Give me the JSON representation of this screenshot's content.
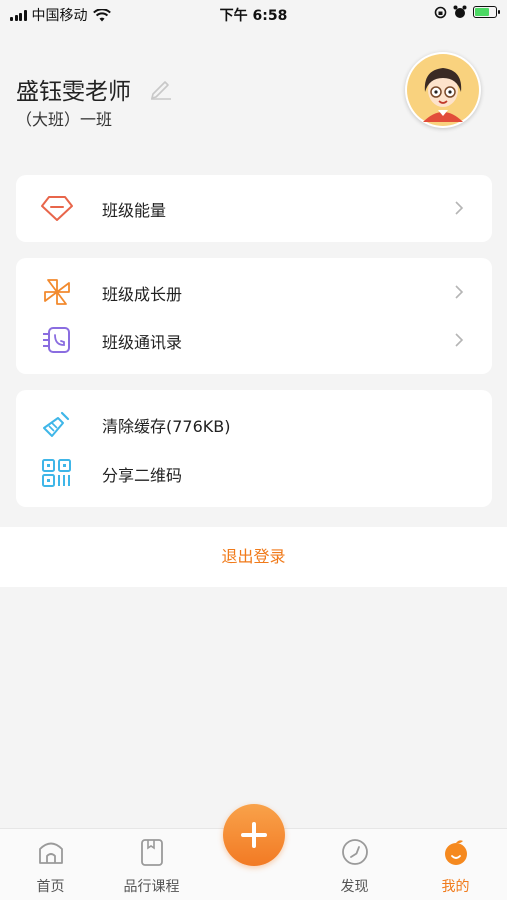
{
  "status_bar": {
    "carrier": "中国移动",
    "time": "下午 6:58"
  },
  "profile": {
    "teacher_name": "盛钰雯老师",
    "class_name": "（大班）一班"
  },
  "menu": {
    "group1": [
      {
        "label": "班级能量",
        "icon": "gem-icon"
      }
    ],
    "group2": [
      {
        "label": "班级成长册",
        "icon": "pinwheel-icon"
      },
      {
        "label": "班级通讯录",
        "icon": "phone-book-icon"
      }
    ],
    "group3": [
      {
        "label": "清除缓存(776KB)",
        "icon": "broom-icon"
      },
      {
        "label": "分享二维码",
        "icon": "qr-code-icon"
      }
    ]
  },
  "logout_label": "退出登录",
  "tabbar": {
    "tabs": [
      {
        "label": "首页",
        "icon": "home-icon"
      },
      {
        "label": "品行课程",
        "icon": "book-icon"
      },
      {
        "label": "发现",
        "icon": "compass-icon"
      },
      {
        "label": "我的",
        "icon": "orange-icon"
      }
    ],
    "active_tab": "我的"
  },
  "colors": {
    "accent": "#f07a1a",
    "background": "#f4f4f4"
  }
}
